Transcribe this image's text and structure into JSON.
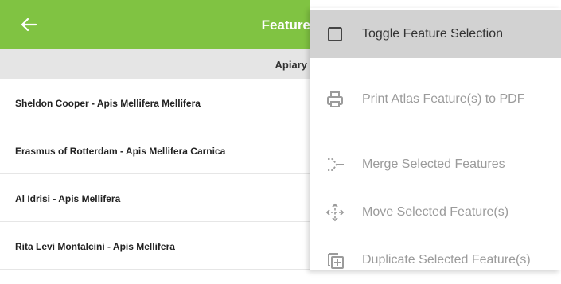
{
  "app_bar": {
    "title": "Feature",
    "back_icon": "arrow-left-icon",
    "color": "#80c342"
  },
  "section": {
    "title": "Apiary"
  },
  "features": [
    {
      "label": "Sheldon Cooper - Apis Mellifera Mellifera"
    },
    {
      "label": "Erasmus of Rotterdam - Apis Mellifera Carnica"
    },
    {
      "label": "Al Idrisi - Apis Mellifera"
    },
    {
      "label": "Rita Levi Montalcini - Apis Mellifera"
    }
  ],
  "menu": {
    "items": [
      {
        "label": "Toggle Feature Selection",
        "icon": "checkbox-icon",
        "enabled": true
      },
      {
        "label": "Print Atlas Feature(s) to PDF",
        "icon": "printer-icon",
        "enabled": false
      },
      {
        "label": "Merge Selected Features",
        "icon": "merge-icon",
        "enabled": false
      },
      {
        "label": "Move Selected Feature(s)",
        "icon": "move-icon",
        "enabled": false
      },
      {
        "label": "Duplicate Selected Feature(s)",
        "icon": "duplicate-icon",
        "enabled": false
      }
    ]
  }
}
